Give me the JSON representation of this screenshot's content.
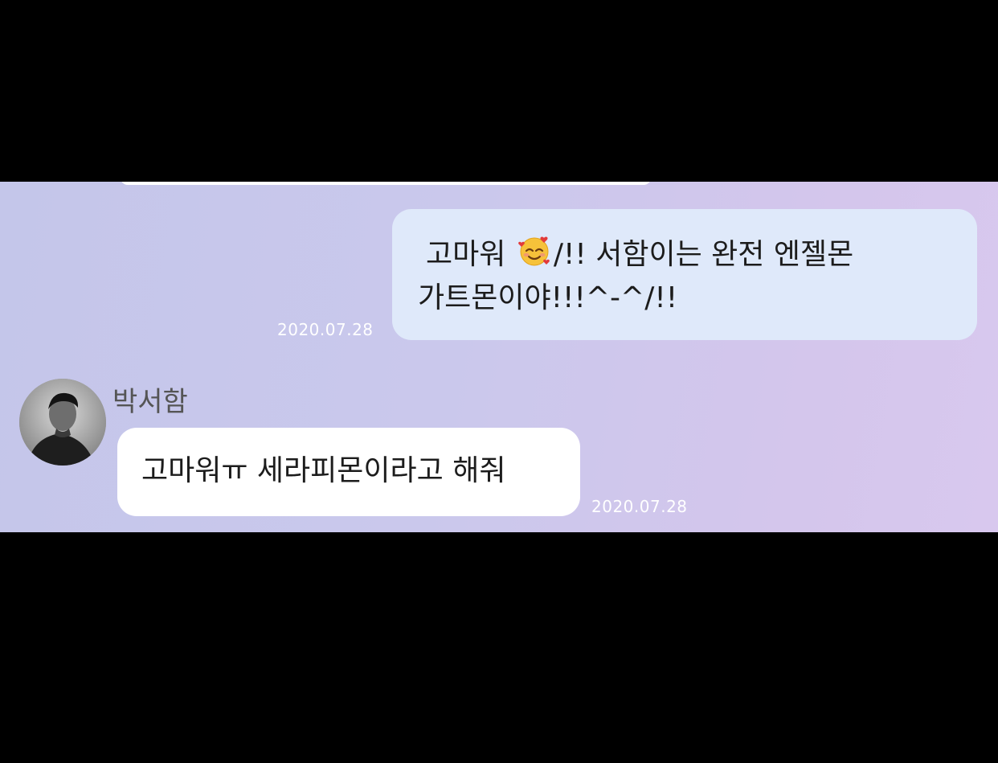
{
  "messages": {
    "outgoing": {
      "line1_part1": "고마워",
      "emoji": "smiling-face-with-hearts",
      "line1_part2": "/!! 서함이는 완전 엔젤몬",
      "line2": "가트몬이야!!!^-^/!!",
      "timestamp": "2020.07.28"
    },
    "incoming": {
      "sender": "박서함",
      "text": "고마워ㅠ 세라피몬이라고 해줘",
      "timestamp": "2020.07.28"
    }
  },
  "colors": {
    "background_start": "#c4c6ea",
    "background_end": "#d8c8ee",
    "outgoing_bubble": "#dfe9fa",
    "incoming_bubble": "#ffffff",
    "timestamp": "#ffffff"
  }
}
